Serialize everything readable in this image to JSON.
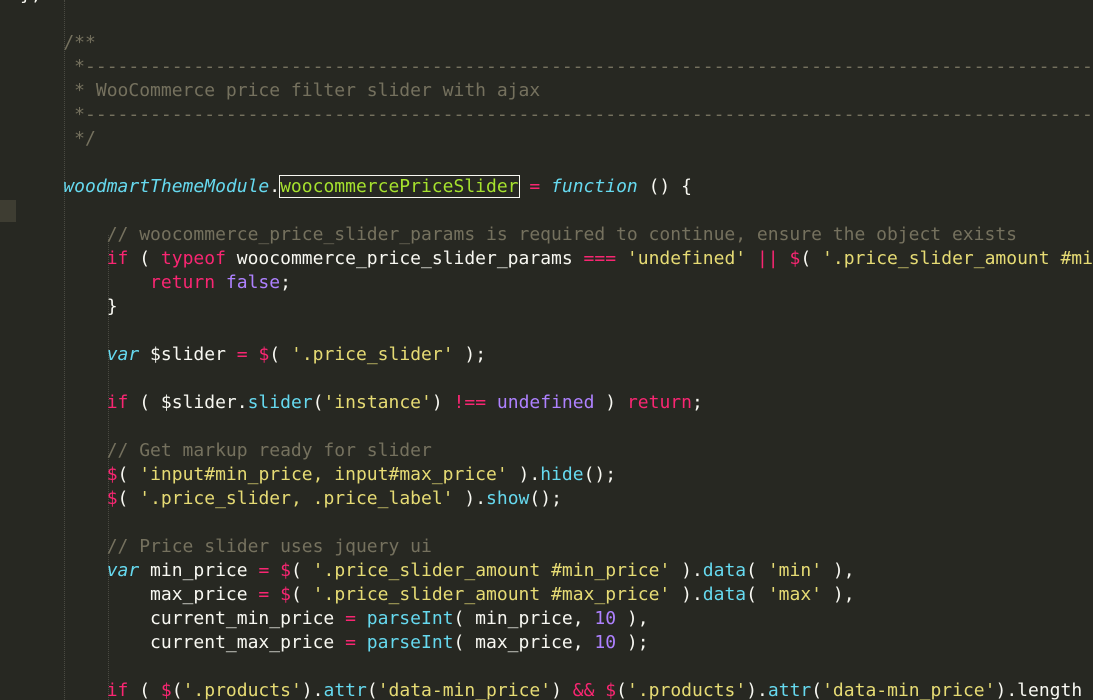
{
  "colors": {
    "background": "#272822",
    "comment": "#75715e",
    "keyword": "#f92672",
    "string": "#e6db74",
    "function_name": "#a6e22e",
    "storage": "#66d9ef",
    "constant": "#ae81ff",
    "plain": "#f8f8f2"
  },
  "lines": [
    {
      "tokens": [
        {
          "t": "plain",
          "v": "};"
        }
      ]
    },
    {
      "tokens": []
    },
    {
      "tokens": [
        {
          "t": "comment",
          "v": "    /**"
        }
      ]
    },
    {
      "tokens": [
        {
          "t": "comment",
          "v": "     *------------------------------------------------------------------------------------------------------------------------"
        }
      ]
    },
    {
      "tokens": [
        {
          "t": "comment",
          "v": "     * WooCommerce price filter slider with ajax"
        }
      ]
    },
    {
      "tokens": [
        {
          "t": "comment",
          "v": "     *------------------------------------------------------------------------------------------------------------------------"
        }
      ]
    },
    {
      "tokens": [
        {
          "t": "comment",
          "v": "     */"
        }
      ]
    },
    {
      "tokens": []
    },
    {
      "tokens": [
        {
          "t": "object",
          "v": "    woodmartThemeModule"
        },
        {
          "t": "plain",
          "v": "."
        },
        {
          "t": "property",
          "v": "woocommercePriceSlider",
          "highlight": true
        },
        {
          "t": "plain",
          "v": " "
        },
        {
          "t": "operator",
          "v": "="
        },
        {
          "t": "plain",
          "v": " "
        },
        {
          "t": "storage",
          "v": "function"
        },
        {
          "t": "plain",
          "v": " () {"
        }
      ]
    },
    {
      "tokens": []
    },
    {
      "tokens": [
        {
          "t": "comment",
          "v": "        // woocommerce_price_slider_params is required to continue, ensure the object exists"
        }
      ]
    },
    {
      "tokens": [
        {
          "t": "keyword",
          "v": "        if"
        },
        {
          "t": "plain",
          "v": " ( "
        },
        {
          "t": "keyword",
          "v": "typeof"
        },
        {
          "t": "plain",
          "v": " woocommerce_price_slider_params "
        },
        {
          "t": "operator",
          "v": "==="
        },
        {
          "t": "plain",
          "v": " "
        },
        {
          "t": "string",
          "v": "'undefined'"
        },
        {
          "t": "plain",
          "v": " "
        },
        {
          "t": "operator",
          "v": "||"
        },
        {
          "t": "plain",
          "v": " "
        },
        {
          "t": "operator",
          "v": "$"
        },
        {
          "t": "plain",
          "v": "( "
        },
        {
          "t": "string",
          "v": "'.price_slider_amount #min_price' ).length"
        }
      ]
    },
    {
      "tokens": [
        {
          "t": "keyword",
          "v": "            return"
        },
        {
          "t": "plain",
          "v": " "
        },
        {
          "t": "constant",
          "v": "false"
        },
        {
          "t": "plain",
          "v": ";"
        }
      ]
    },
    {
      "tokens": [
        {
          "t": "plain",
          "v": "        }"
        }
      ]
    },
    {
      "tokens": []
    },
    {
      "tokens": [
        {
          "t": "storage",
          "v": "        var"
        },
        {
          "t": "plain",
          "v": " $slider "
        },
        {
          "t": "operator",
          "v": "="
        },
        {
          "t": "plain",
          "v": " "
        },
        {
          "t": "operator",
          "v": "$"
        },
        {
          "t": "plain",
          "v": "( "
        },
        {
          "t": "string",
          "v": "'.price_slider'"
        },
        {
          "t": "plain",
          "v": " );"
        }
      ]
    },
    {
      "tokens": []
    },
    {
      "tokens": [
        {
          "t": "keyword",
          "v": "        if"
        },
        {
          "t": "plain",
          "v": " ( $slider."
        },
        {
          "t": "method",
          "v": "slider"
        },
        {
          "t": "plain",
          "v": "("
        },
        {
          "t": "string",
          "v": "'instance'"
        },
        {
          "t": "plain",
          "v": ") "
        },
        {
          "t": "operator",
          "v": "!=="
        },
        {
          "t": "plain",
          "v": " "
        },
        {
          "t": "constant",
          "v": "undefined"
        },
        {
          "t": "plain",
          "v": " ) "
        },
        {
          "t": "keyword",
          "v": "return"
        },
        {
          "t": "plain",
          "v": ";"
        }
      ]
    },
    {
      "tokens": []
    },
    {
      "tokens": [
        {
          "t": "comment",
          "v": "        // Get markup ready for slider"
        }
      ]
    },
    {
      "tokens": [
        {
          "t": "operator",
          "v": "        $"
        },
        {
          "t": "plain",
          "v": "( "
        },
        {
          "t": "string",
          "v": "'input#min_price, input#max_price'"
        },
        {
          "t": "plain",
          "v": " )."
        },
        {
          "t": "method",
          "v": "hide"
        },
        {
          "t": "plain",
          "v": "();"
        }
      ]
    },
    {
      "tokens": [
        {
          "t": "operator",
          "v": "        $"
        },
        {
          "t": "plain",
          "v": "( "
        },
        {
          "t": "string",
          "v": "'.price_slider, .price_label'"
        },
        {
          "t": "plain",
          "v": " )."
        },
        {
          "t": "method",
          "v": "show"
        },
        {
          "t": "plain",
          "v": "();"
        }
      ]
    },
    {
      "tokens": []
    },
    {
      "tokens": [
        {
          "t": "comment",
          "v": "        // Price slider uses jquery ui"
        }
      ]
    },
    {
      "tokens": [
        {
          "t": "storage",
          "v": "        var"
        },
        {
          "t": "plain",
          "v": " min_price "
        },
        {
          "t": "operator",
          "v": "="
        },
        {
          "t": "plain",
          "v": " "
        },
        {
          "t": "operator",
          "v": "$"
        },
        {
          "t": "plain",
          "v": "( "
        },
        {
          "t": "string",
          "v": "'.price_slider_amount #min_price'"
        },
        {
          "t": "plain",
          "v": " )."
        },
        {
          "t": "method",
          "v": "data"
        },
        {
          "t": "plain",
          "v": "( "
        },
        {
          "t": "string",
          "v": "'min'"
        },
        {
          "t": "plain",
          "v": " ),"
        }
      ]
    },
    {
      "tokens": [
        {
          "t": "plain",
          "v": "            max_price "
        },
        {
          "t": "operator",
          "v": "="
        },
        {
          "t": "plain",
          "v": " "
        },
        {
          "t": "operator",
          "v": "$"
        },
        {
          "t": "plain",
          "v": "( "
        },
        {
          "t": "string",
          "v": "'.price_slider_amount #max_price'"
        },
        {
          "t": "plain",
          "v": " )."
        },
        {
          "t": "method",
          "v": "data"
        },
        {
          "t": "plain",
          "v": "( "
        },
        {
          "t": "string",
          "v": "'max'"
        },
        {
          "t": "plain",
          "v": " ),"
        }
      ]
    },
    {
      "tokens": [
        {
          "t": "plain",
          "v": "            current_min_price "
        },
        {
          "t": "operator",
          "v": "="
        },
        {
          "t": "plain",
          "v": " "
        },
        {
          "t": "method",
          "v": "parseInt"
        },
        {
          "t": "plain",
          "v": "( min_price, "
        },
        {
          "t": "number",
          "v": "10"
        },
        {
          "t": "plain",
          "v": " ),"
        }
      ]
    },
    {
      "tokens": [
        {
          "t": "plain",
          "v": "            current_max_price "
        },
        {
          "t": "operator",
          "v": "="
        },
        {
          "t": "plain",
          "v": " "
        },
        {
          "t": "method",
          "v": "parseInt"
        },
        {
          "t": "plain",
          "v": "( max_price, "
        },
        {
          "t": "number",
          "v": "10"
        },
        {
          "t": "plain",
          "v": " );"
        }
      ]
    },
    {
      "tokens": []
    },
    {
      "tokens": [
        {
          "t": "keyword",
          "v": "        if"
        },
        {
          "t": "plain",
          "v": " ( "
        },
        {
          "t": "operator",
          "v": "$"
        },
        {
          "t": "plain",
          "v": "("
        },
        {
          "t": "string",
          "v": "'.products'"
        },
        {
          "t": "plain",
          "v": ")."
        },
        {
          "t": "method",
          "v": "attr"
        },
        {
          "t": "plain",
          "v": "("
        },
        {
          "t": "string",
          "v": "'data-min_price'"
        },
        {
          "t": "plain",
          "v": ") "
        },
        {
          "t": "operator",
          "v": "&&"
        },
        {
          "t": "plain",
          "v": " "
        },
        {
          "t": "operator",
          "v": "$"
        },
        {
          "t": "plain",
          "v": "("
        },
        {
          "t": "string",
          "v": "'.products'"
        },
        {
          "t": "plain",
          "v": ")."
        },
        {
          "t": "method",
          "v": "attr"
        },
        {
          "t": "plain",
          "v": "("
        },
        {
          "t": "string",
          "v": "'data-min_price'"
        },
        {
          "t": "plain",
          "v": ").length"
        }
      ]
    }
  ]
}
